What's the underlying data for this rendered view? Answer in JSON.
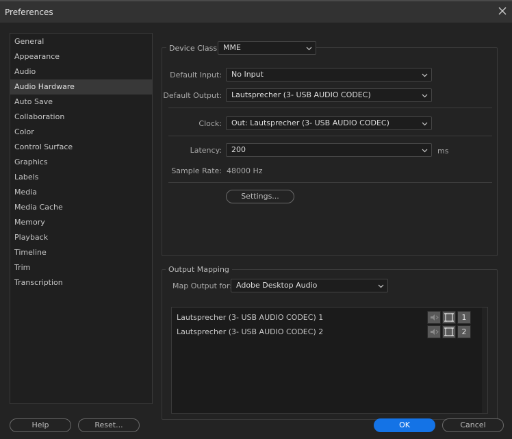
{
  "window": {
    "title": "Preferences"
  },
  "sidebar": {
    "items": [
      {
        "label": "General"
      },
      {
        "label": "Appearance"
      },
      {
        "label": "Audio"
      },
      {
        "label": "Audio Hardware",
        "selected": true
      },
      {
        "label": "Auto Save"
      },
      {
        "label": "Collaboration"
      },
      {
        "label": "Color"
      },
      {
        "label": "Control Surface"
      },
      {
        "label": "Graphics"
      },
      {
        "label": "Labels"
      },
      {
        "label": "Media"
      },
      {
        "label": "Media Cache"
      },
      {
        "label": "Memory"
      },
      {
        "label": "Playback"
      },
      {
        "label": "Timeline"
      },
      {
        "label": "Trim"
      },
      {
        "label": "Transcription"
      }
    ]
  },
  "device": {
    "class_label": "Device Class:",
    "class_value": "MME",
    "input_label": "Default Input:",
    "input_value": "No Input",
    "output_label": "Default Output:",
    "output_value": "Lautsprecher (3- USB AUDIO  CODEC)",
    "clock_label": "Clock:",
    "clock_value": "Out: Lautsprecher (3- USB AUDIO  CODEC)",
    "latency_label": "Latency:",
    "latency_value": "200",
    "latency_unit": "ms",
    "samplerate_label": "Sample Rate:",
    "samplerate_value": "48000 Hz",
    "settings_button": "Settings..."
  },
  "output_mapping": {
    "title": "Output Mapping",
    "map_label": "Map Output for:",
    "map_value": "Adobe Desktop Audio",
    "rows": [
      {
        "label": "Lautsprecher (3- USB AUDIO  CODEC) 1",
        "channel": "1"
      },
      {
        "label": "Lautsprecher (3- USB AUDIO  CODEC) 2",
        "channel": "2"
      }
    ]
  },
  "footer": {
    "help": "Help",
    "reset": "Reset...",
    "ok": "OK",
    "cancel": "Cancel"
  },
  "colors": {
    "background": "#232323",
    "accent": "#1473e6",
    "selected_item": "#383838"
  }
}
